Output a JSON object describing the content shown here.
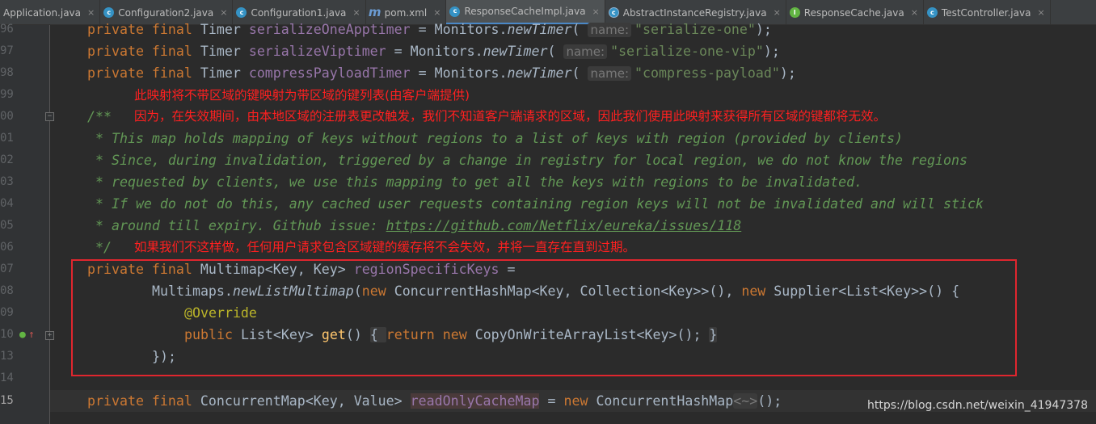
{
  "tabs": [
    {
      "label": "Application.java",
      "icon": "none",
      "glyph": ""
    },
    {
      "label": "Configuration2.java",
      "icon": "c",
      "glyph": "c"
    },
    {
      "label": "Configuration1.java",
      "icon": "c",
      "glyph": "c"
    },
    {
      "label": "pom.xml",
      "icon": "m",
      "glyph": "m"
    },
    {
      "label": "ResponseCacheImpl.java",
      "icon": "c",
      "glyph": "c",
      "active": true
    },
    {
      "label": "AbstractInstanceRegistry.java",
      "icon": "ac",
      "glyph": "c"
    },
    {
      "label": "ResponseCache.java",
      "icon": "rc",
      "glyph": "I"
    },
    {
      "label": "TestController.java",
      "icon": "c",
      "glyph": "c"
    }
  ],
  "tab_close_glyph": "×",
  "line_numbers": [
    "96",
    "97",
    "98",
    "99",
    "00",
    "01",
    "02",
    "03",
    "04",
    "05",
    "06",
    "07",
    "08",
    "09",
    "10",
    "13",
    "14",
    "15"
  ],
  "code": {
    "l96": {
      "kw": "private final ",
      "type": "Timer ",
      "field": "serializeOneApptimer",
      "eq": " = Monitors.",
      "fn": "newTimer",
      "open": "( ",
      "hint": "name:",
      "str": "\"serialize-one\"",
      "close": ");"
    },
    "l97": {
      "kw": "private final ",
      "type": "Timer ",
      "field": "serializeViptimer",
      "eq": " = Monitors.",
      "fn": "newTimer",
      "open": "( ",
      "hint": "name:",
      "str": "\"serialize-one-vip\"",
      "close": ");"
    },
    "l98": {
      "kw": "private final ",
      "type": "Timer ",
      "field": "compressPayloadTimer",
      "eq": " = Monitors.",
      "fn": "newTimer",
      "open": "( ",
      "hint": "name:",
      "str": "\"compress-payload\"",
      "close": ");"
    },
    "l100": "/**",
    "l101": " * This map holds mapping of keys without regions to a list of keys with region (provided by clients)",
    "l102": " * Since, during invalidation, triggered by a change in registry for local region, we do not know the regions",
    "l103": " * requested by clients, we use this mapping to get all the keys with regions to be invalidated.",
    "l104": " * If we do not do this, any cached user requests containing region keys will not be invalidated and will stick",
    "l105_text": " * around till expiry. Github issue: ",
    "l105_link": "https://github.com/Netflix/eureka/issues/118",
    "l106": " */",
    "l107": {
      "kw": "private final ",
      "type": "Multimap<Key, Key> ",
      "field": "regionSpecificKeys",
      "rest": " ="
    },
    "l108": {
      "pre": "Multimaps.",
      "fn": "newListMultimap",
      "a": "(",
      "kw1": "new ",
      "b": "ConcurrentHashMap<Key, Collection<Key>>(), ",
      "kw2": "new ",
      "c": "Supplier<List<Key>>() {"
    },
    "l109": "@Override",
    "l110": {
      "kw": "public ",
      "type": "List<Key> ",
      "fn": "get",
      "paren": "() ",
      "ob": "{ ",
      "ret": "return ",
      "nw": "new ",
      "body": "CopyOnWriteArrayList<Key>(); ",
      "cb": "}"
    },
    "l113": "});",
    "l115": {
      "kw": "private final ",
      "type": "ConcurrentMap<Key, Value> ",
      "field": "readOnlyCacheMap",
      "eq": " = ",
      "nw": "new ",
      "cls": "ConcurrentHashMap",
      "dia": "<~>",
      "end": "();"
    }
  },
  "annotations": {
    "note1": "此映射将不带区域的键映射为带区域的键列表(由客户端提供)",
    "note2": "因为，在失效期间，由本地区域的注册表更改触发，我们不知道客户端请求的区域，因此我们使用此映射来获得所有区域的键都将无效。",
    "note3": "如果我们不这样做，任何用户请求包含区域键的缓存将不会失效，并将一直存在直到过期。"
  },
  "watermark": "https://blog.csdn.net/weixin_41947378",
  "colors": {
    "background": "#2b2b2b",
    "keyword": "#cc7832",
    "field": "#9876aa",
    "string": "#6a8759",
    "doc_comment": "#629755",
    "annotation": "#bbb529",
    "highlight_box": "#e0262e",
    "note_text": "#ff2020"
  }
}
